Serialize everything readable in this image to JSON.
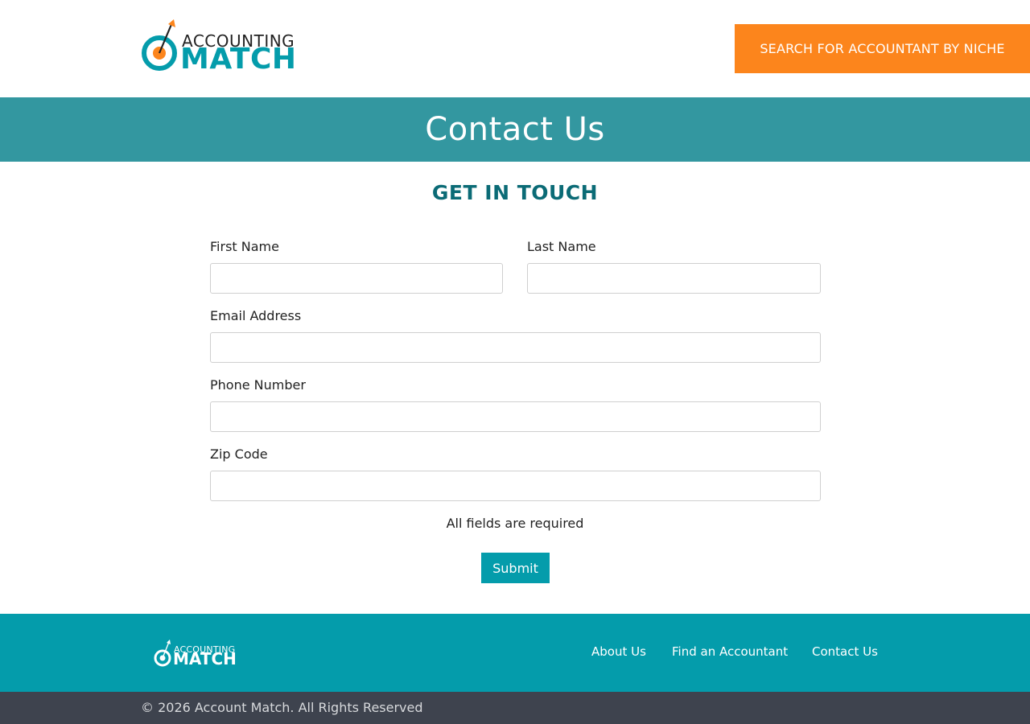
{
  "header": {
    "logo": {
      "top_word": "ACCOUNTING",
      "bottom_word": "MATCH"
    },
    "cta_label": "SEARCH FOR ACCOUNTANT BY NICHE"
  },
  "banner": {
    "title": "Contact Us"
  },
  "form": {
    "heading": "GET IN TOUCH",
    "first_name": {
      "label": "First Name",
      "value": "",
      "placeholder": ""
    },
    "last_name": {
      "label": "Last Name",
      "value": "",
      "placeholder": ""
    },
    "email": {
      "label": "Email Address",
      "value": "",
      "placeholder": ""
    },
    "phone": {
      "label": "Phone Number",
      "value": "",
      "placeholder": ""
    },
    "zip": {
      "label": "Zip Code",
      "value": "",
      "placeholder": ""
    },
    "note": "All fields are required",
    "submit_label": "Submit"
  },
  "footer": {
    "logo": {
      "top_word": "ACCOUNTING",
      "bottom_word": "MATCH"
    },
    "nav": [
      "About Us",
      "Find an Accountant",
      "Contact Us"
    ],
    "copyright": "© 2026 Account Match. All Rights Reserved"
  },
  "colors": {
    "brand_teal": "#049cab",
    "banner_teal": "#3397a0",
    "heading_teal": "#0b6b76",
    "cta_orange": "#fc851c",
    "copyright_bar": "#3e434e"
  },
  "icons": [
    "target-arrow-logo-icon"
  ]
}
